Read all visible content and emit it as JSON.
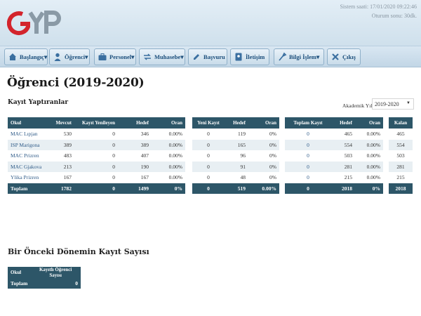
{
  "header": {
    "logo_text": "GYP",
    "system_time": "Sistem saati: 17/01/2020 09:22:46",
    "session": "Oturum sonu: 30dk."
  },
  "nav": [
    {
      "label": "Başlangıç",
      "icon": "home-icon"
    },
    {
      "label": "Öğrenci",
      "icon": "student-icon"
    },
    {
      "label": "Personel",
      "icon": "briefcase-icon"
    },
    {
      "label": "Muhasebe",
      "icon": "transfer-icon"
    },
    {
      "label": "Başvuru",
      "icon": "edit-icon"
    },
    {
      "label": "İletişim",
      "icon": "contact-icon"
    },
    {
      "label": "Bilgi İşlem",
      "icon": "tools-icon"
    },
    {
      "label": "Çıkış",
      "icon": "exit-icon"
    }
  ],
  "page": {
    "title": "Öğrenci (2019-2020)",
    "section1": "Kayıt Yaptıranlar",
    "year_label": "Akademik Yıl",
    "year_value": "2019-2020",
    "section2": "Bir Önceki Dönemin Kayıt Sayısı"
  },
  "table1": {
    "headers": [
      "Okul",
      "Mevcut",
      "Kayıt Yenileyen",
      "Hedef",
      "Oran"
    ],
    "rows": [
      [
        "MAC Lıpjan",
        "530",
        "0",
        "346",
        "0.00%"
      ],
      [
        "ISP Marigona",
        "389",
        "0",
        "389",
        "0.00%"
      ],
      [
        "MAC Prizren",
        "483",
        "0",
        "407",
        "0.00%"
      ],
      [
        "MAC Gjakova",
        "213",
        "0",
        "190",
        "0.00%"
      ],
      [
        "Ylika Prizren",
        "167",
        "0",
        "167",
        "0.00%"
      ]
    ],
    "total": [
      "Toplam",
      "1782",
      "0",
      "1499",
      "0%"
    ]
  },
  "table2": {
    "headers": [
      "Yeni Kayıt",
      "Hedef",
      "Oran"
    ],
    "rows": [
      [
        "0",
        "119",
        "0%"
      ],
      [
        "0",
        "165",
        "0%"
      ],
      [
        "0",
        "96",
        "0%"
      ],
      [
        "0",
        "91",
        "0%"
      ],
      [
        "0",
        "48",
        "0%"
      ]
    ],
    "total": [
      "0",
      "519",
      "0.00%"
    ]
  },
  "table3": {
    "headers": [
      "Toplam Kayıt",
      "Hedef",
      "Oran"
    ],
    "rows": [
      [
        "0",
        "465",
        "0.00%"
      ],
      [
        "0",
        "554",
        "0.00%"
      ],
      [
        "0",
        "503",
        "0.00%"
      ],
      [
        "0",
        "281",
        "0.00%"
      ],
      [
        "0",
        "215",
        "0.00%"
      ]
    ],
    "total": [
      "0",
      "2018",
      "0%"
    ]
  },
  "table4": {
    "headers": [
      "Kalan"
    ],
    "rows": [
      [
        "465"
      ],
      [
        "554"
      ],
      [
        "503"
      ],
      [
        "281"
      ],
      [
        "215"
      ]
    ],
    "total": [
      "2018"
    ]
  },
  "table5": {
    "headers": [
      "Okul",
      "Kayıtlı Öğrenci Sayısı"
    ],
    "total": [
      "Toplam",
      "0"
    ]
  }
}
